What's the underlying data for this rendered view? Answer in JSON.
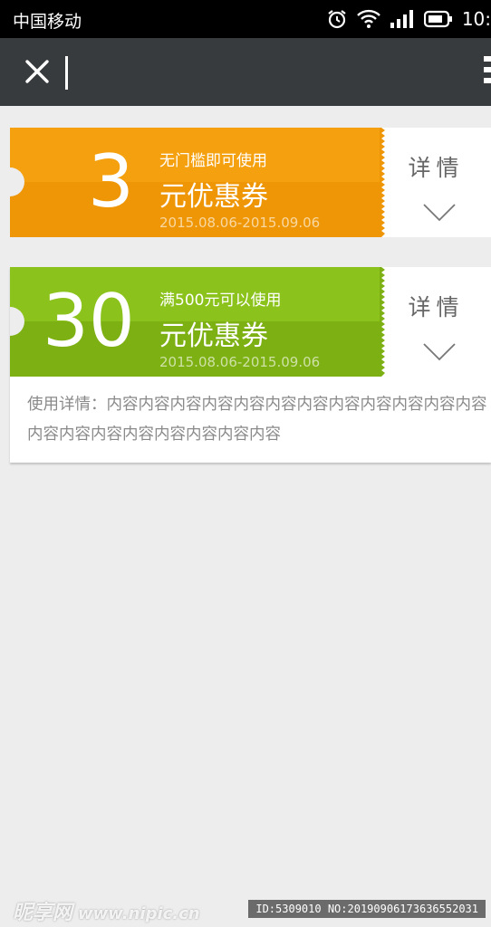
{
  "status_bar": {
    "carrier": "中国移动",
    "time": "10:",
    "icons": [
      "alarm-icon",
      "wifi-icon",
      "signal-icon",
      "battery-icon"
    ]
  },
  "nav": {
    "close_icon": "close-icon",
    "menu_icon": "more-icon"
  },
  "coupons": [
    {
      "amount": "3",
      "condition": "无门槛即可使用",
      "title": "元优惠券",
      "date_range": "2015.08.06-2015.09.06",
      "detail_label": "详情",
      "color": "#f5a00e",
      "expanded": false
    },
    {
      "amount": "30",
      "condition": "满500元可以使用",
      "title": "元优惠券",
      "date_range": "2015.08.06-2015.09.06",
      "detail_label": "详情",
      "color": "#8bc21b",
      "expanded": true,
      "usage_details": "使用详情：内容内容内容内容内容内容内容内容内容内容内容内容内容内容内容内容内容内容内容内容"
    }
  ],
  "watermark": {
    "logo": "昵享网",
    "site": "www.nipic.cn",
    "id_text": "ID:5309010 NO:20190906173636552031"
  }
}
